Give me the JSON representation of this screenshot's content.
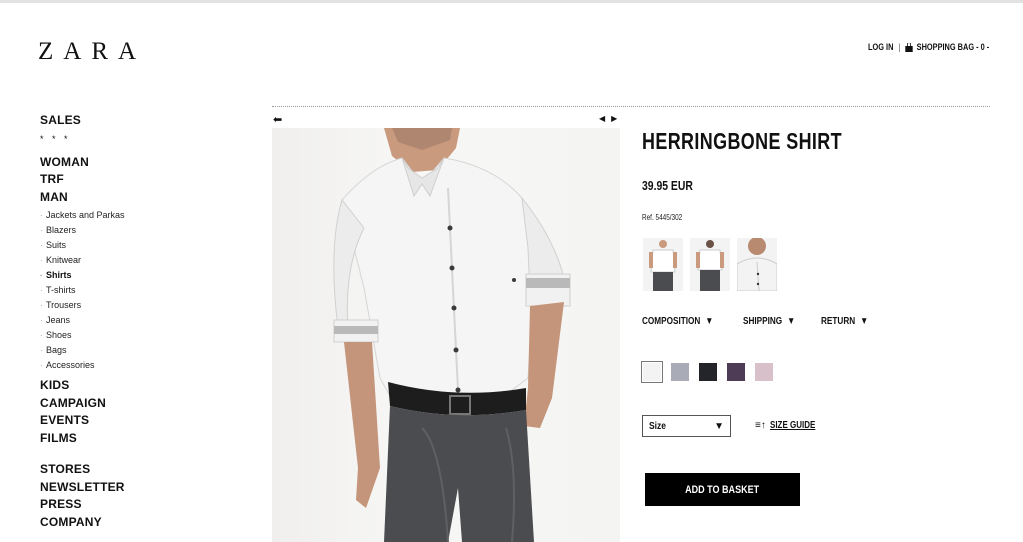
{
  "brand": {
    "logo_text": "ZARA"
  },
  "account": {
    "login_label": "LOG IN",
    "separator": "|",
    "bag_label": "SHOPPING BAG - 0 -"
  },
  "sidebar": {
    "sales": "SALES",
    "stars": "* * *",
    "main": [
      "WOMAN",
      "TRF",
      "MAN"
    ],
    "man_sub": [
      "Jackets and Parkas",
      "Blazers",
      "Suits",
      "Knitwear",
      "Shirts",
      "T-shirts",
      "Trousers",
      "Jeans",
      "Shoes",
      "Bags",
      "Accessories"
    ],
    "active_sub": "Shirts",
    "more": [
      "KIDS",
      "CAMPAIGN",
      "EVENTS",
      "FILMS"
    ],
    "info": [
      "STORES",
      "NEWSLETTER",
      "PRESS",
      "COMPANY"
    ]
  },
  "product": {
    "name": "HERRINGBONE SHIRT",
    "price": "39.95 EUR",
    "ref": "Ref. 5445/302",
    "tabs": [
      "COMPOSITION",
      "SHIPPING",
      "RETURN"
    ],
    "colors": [
      "#f3f3f3",
      "#a9abb6",
      "#23252b",
      "#4e3c56",
      "#d8c0cb"
    ],
    "selected_color_index": 0,
    "size_placeholder": "Size",
    "size_guide": "SIZE GUIDE",
    "add_to_basket": "ADD TO BASKET"
  },
  "icons": {
    "back": "back-arrow-icon",
    "prev": "prev-arrow-icon",
    "next": "next-arrow-icon",
    "bag": "shopping-bag-icon",
    "dropdown": "triangle-down-icon",
    "size_guide": "ruler-icon"
  }
}
